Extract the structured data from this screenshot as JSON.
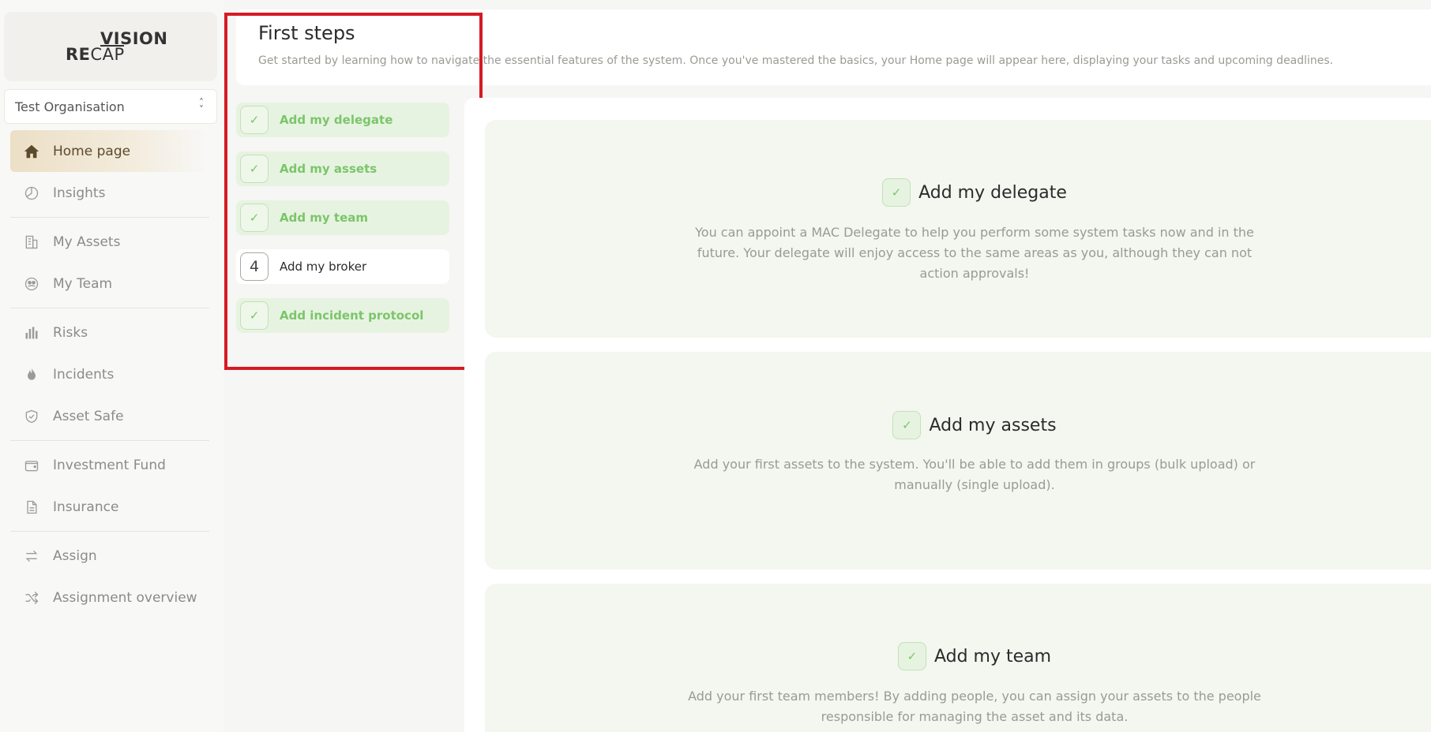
{
  "logo": {
    "top": "VISION",
    "bottom_bold": "RE",
    "bottom_rest": "CAP"
  },
  "org": {
    "selected": "Test Organisation"
  },
  "nav": [
    {
      "label": "Home page",
      "icon": "home-icon",
      "active": true
    },
    {
      "label": "Insights",
      "icon": "pie-chart-icon"
    },
    {
      "label": "My Assets",
      "icon": "building-icon"
    },
    {
      "label": "My Team",
      "icon": "team-icon"
    },
    {
      "label": "Risks",
      "icon": "bar-chart-icon"
    },
    {
      "label": "Incidents",
      "icon": "fire-icon"
    },
    {
      "label": "Asset Safe",
      "icon": "shield-icon"
    },
    {
      "label": "Investment Fund",
      "icon": "wallet-icon"
    },
    {
      "label": "Insurance",
      "icon": "document-icon"
    },
    {
      "label": "Assign",
      "icon": "arrows-exchange-icon"
    },
    {
      "label": "Assignment overview",
      "icon": "shuffle-icon"
    }
  ],
  "header": {
    "title": "First steps",
    "subtitle": "Get started by learning how to navigate the essential features of the system. Once you've mastered the basics, your Home page will appear here, displaying your tasks and upcoming deadlines."
  },
  "steps": [
    {
      "marker": "✓",
      "label": "Add my delegate",
      "done": true
    },
    {
      "marker": "✓",
      "label": "Add my assets",
      "done": true
    },
    {
      "marker": "✓",
      "label": "Add my team",
      "done": true
    },
    {
      "marker": "4",
      "label": "Add my broker",
      "done": false
    },
    {
      "marker": "✓",
      "label": "Add incident protocol",
      "done": true
    }
  ],
  "cards": [
    {
      "title": "Add my delegate",
      "desc": "You can appoint a MAC Delegate to help you perform some system tasks now and in the future. Your delegate will enjoy access to the same areas as you, although they can not action approvals!"
    },
    {
      "title": "Add my assets",
      "desc": "Add your first assets to the system. You'll be able to add them in groups (bulk upload) or manually (single upload)."
    },
    {
      "title": "Add my team",
      "desc": "Add your first team members! By adding people, you can assign your assets to the people responsible for managing the asset and its data."
    }
  ],
  "colors": {
    "accent_green": "#7bc56a",
    "active_nav": "#ecdfc6",
    "highlight": "#d51b24"
  }
}
